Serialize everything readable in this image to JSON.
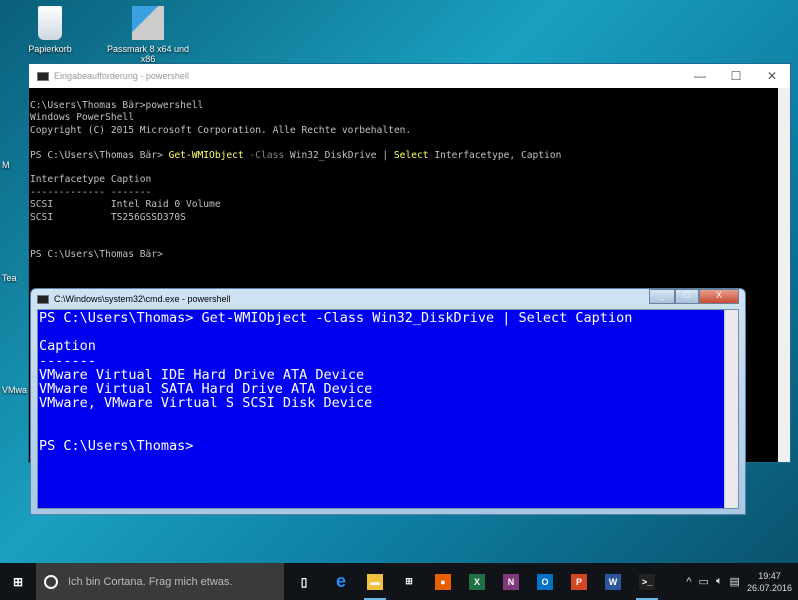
{
  "desktop": {
    "icons": [
      {
        "label": "Papierkorb"
      },
      {
        "label": "Passmark 8 x64 und x86"
      }
    ],
    "edge_labels": [
      "M",
      "Tea",
      "VMwa"
    ]
  },
  "back_window": {
    "title": "Eingabeaufforderung - powershell",
    "lines": {
      "l1": "C:\\Users\\Thomas Bär>powershell",
      "l2": "Windows PowerShell",
      "l3": "Copyright (C) 2015 Microsoft Corporation. Alle Rechte vorbehalten.",
      "prompt": "PS C:\\Users\\Thomas Bär> ",
      "cmd1": "Get-WMIObject",
      "param": " -Class",
      "arg": " Win32_DiskDrive | ",
      "cmd2": "Select",
      "args2": " Interfacetype, Caption",
      "h": "Interfacetype Caption",
      "d": "------------- -------",
      "r1": "SCSI          Intel Raid 0 Volume",
      "r2": "SCSI          TS256GSSD370S",
      "p2": "PS C:\\Users\\Thomas Bär>"
    }
  },
  "front_window": {
    "title": "C:\\Windows\\system32\\cmd.exe - powershell",
    "lines": {
      "c": "PS C:\\Users\\Thomas> Get-WMIObject -Class Win32_DiskDrive | Select Caption",
      "h": "Caption",
      "d": "-------",
      "r1": "VMware Virtual IDE Hard Drive ATA Device",
      "r2": "VMware Virtual SATA Hard Drive ATA Device",
      "r3": "VMware, VMware Virtual S SCSI Disk Device",
      "p": "PS C:\\Users\\Thomas>"
    }
  },
  "taskbar": {
    "search_placeholder": "Ich bin Cortana. Frag mich etwas.",
    "time": "19:47",
    "date": "26.07.2016",
    "apps": [
      {
        "name": "edge",
        "glyph": "e",
        "color": "#1e90ff"
      },
      {
        "name": "explorer",
        "glyph": "▬",
        "color": "#f0c040"
      },
      {
        "name": "store",
        "glyph": "⊞",
        "color": "#ffffff"
      },
      {
        "name": "firefox",
        "glyph": "●",
        "color": "#e66000"
      },
      {
        "name": "excel",
        "glyph": "X",
        "color": "#1e7145"
      },
      {
        "name": "onenote",
        "glyph": "N",
        "color": "#80397b"
      },
      {
        "name": "outlook",
        "glyph": "O",
        "color": "#0072c6"
      },
      {
        "name": "powerpoint",
        "glyph": "P",
        "color": "#d24726"
      },
      {
        "name": "word",
        "glyph": "W",
        "color": "#2b579a"
      },
      {
        "name": "cmd",
        "glyph": ">_",
        "color": "#222222"
      }
    ]
  }
}
